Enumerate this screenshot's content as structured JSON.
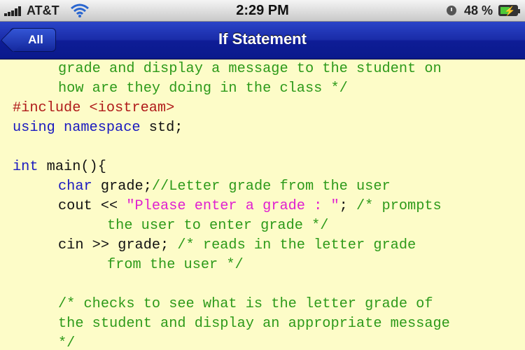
{
  "status_bar": {
    "carrier": "AT&T",
    "time": "2:29 PM",
    "battery_percent": "48 %",
    "icons": [
      "signal-icon",
      "wifi-icon",
      "alarm-icon",
      "battery-charging-icon"
    ]
  },
  "nav": {
    "back_label": "All",
    "title": "If Statement"
  },
  "code": {
    "line1": "grade and display a message to the student on",
    "line2": "how are they doing in the class */",
    "line3_kw": "#include",
    "line3_rest": " <iostream>",
    "line4_kw1": "using",
    "line4_kw2": "namespace",
    "line4_rest": " std;",
    "line6_kw": "int",
    "line6_rest": " main(){",
    "line7_kw": "char",
    "line7_plain": " grade;",
    "line7_comment": "//Letter grade from the user",
    "line8_plain": "cout << ",
    "line8_string": "\"Please enter a grade : \"",
    "line8_rest": "; ",
    "line8_comment": "/* prompts",
    "line9": "the user to enter grade */",
    "line10_plain": "cin >> grade; ",
    "line10_comment": "/* reads in the letter grade",
    "line11": "from the user */",
    "line13": "/* checks to see what is the letter grade of",
    "line14": "the student and display an appropriate message",
    "line15": "*/"
  },
  "colors": {
    "nav_bar": "#1a2ca8",
    "code_background": "#fdfcc8",
    "comment": "#2d9a1a",
    "preprocessor": "#b01a1a",
    "keyword": "#1a1ac0",
    "string": "#e020d0"
  }
}
